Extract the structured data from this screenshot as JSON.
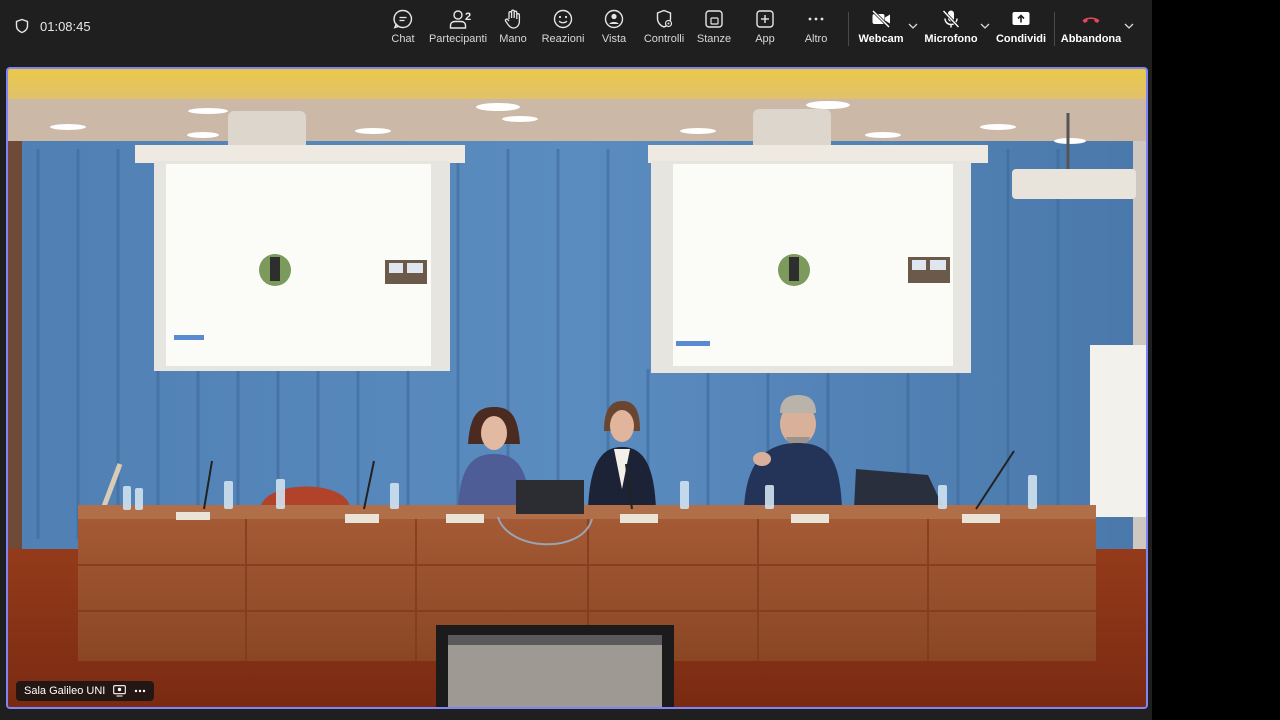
{
  "meeting": {
    "duration": "01:08:45"
  },
  "toolbar": {
    "chat_label": "Chat",
    "participants_label": "Partecipanti",
    "participants_count": "2",
    "hand_label": "Mano",
    "reactions_label": "Reazioni",
    "view_label": "Vista",
    "controls_label": "Controlli",
    "rooms_label": "Stanze",
    "apps_label": "App",
    "more_label": "Altro",
    "webcam_label": "Webcam",
    "mic_label": "Microfono",
    "share_label": "Condividi",
    "leave_label": "Abbandona"
  },
  "video": {
    "participant_name": "Sala Galileo UNI"
  },
  "colors": {
    "accent_border": "#7f85f5",
    "leave_red": "#e0495a",
    "toolbar_bg": "#1f1f1f"
  }
}
